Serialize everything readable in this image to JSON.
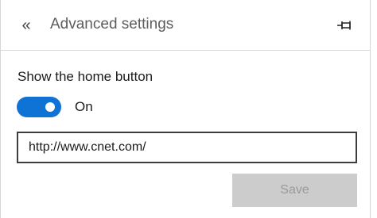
{
  "header": {
    "back_icon": "double-chevron-left-icon",
    "back_glyph": "«",
    "title": "Advanced settings",
    "pin_icon": "pin-icon"
  },
  "home_button_setting": {
    "label": "Show the home button",
    "toggle_on": true,
    "toggle_state_text": "On",
    "toggle_color": "#0f73d6",
    "url_value": "http://www.cnet.com/"
  },
  "actions": {
    "save_label": "Save",
    "save_enabled": false
  }
}
